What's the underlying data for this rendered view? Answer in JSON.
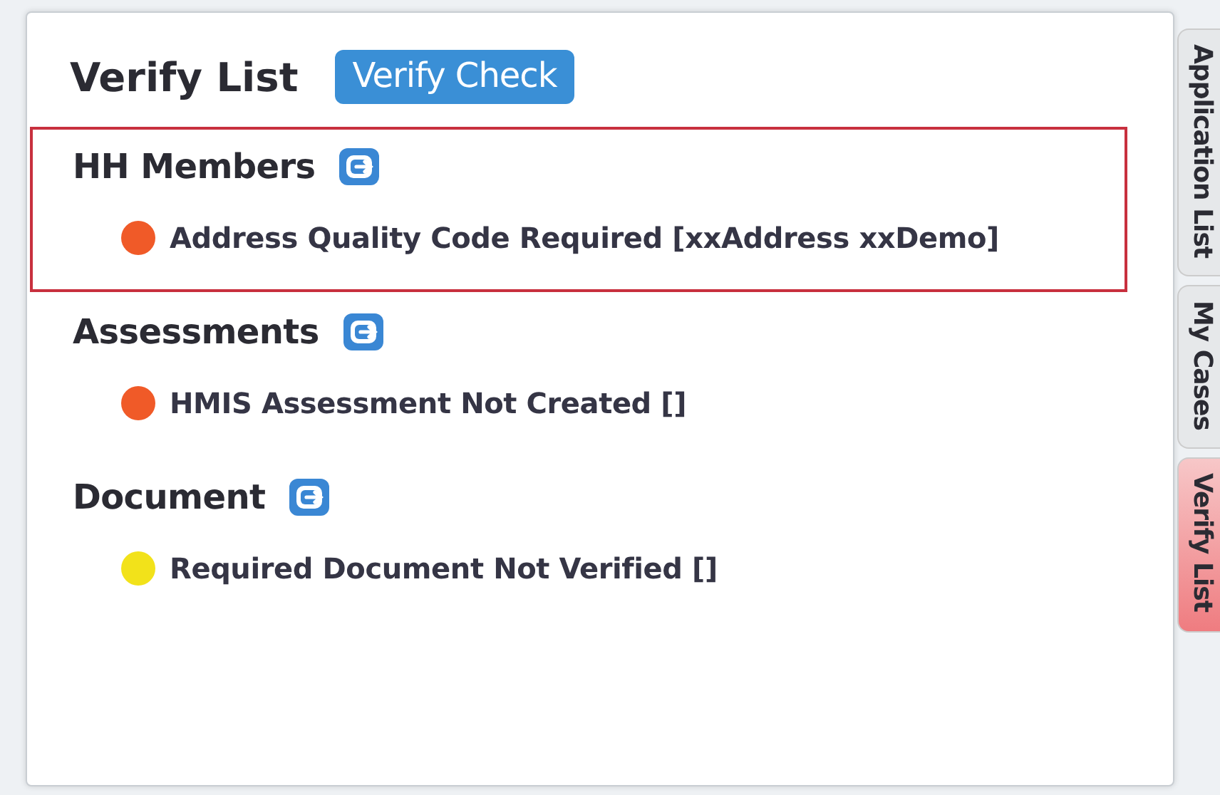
{
  "panel": {
    "title": "Verify List",
    "action_button": "Verify Check"
  },
  "sections": [
    {
      "heading": "HH Members",
      "highlighted": true,
      "items": [
        {
          "text": "Address Quality Code Required [xxAddress xxDemo]",
          "color": "#f05a28"
        }
      ]
    },
    {
      "heading": "Assessments",
      "highlighted": false,
      "items": [
        {
          "text": "HMIS Assessment Not Created []",
          "color": "#f05a28"
        }
      ]
    },
    {
      "heading": "Document",
      "highlighted": false,
      "items": [
        {
          "text": "Required Document Not Verified []",
          "color": "#f2e21a"
        }
      ]
    }
  ],
  "side_tabs": [
    {
      "label": "Application List",
      "selected": false
    },
    {
      "label": "My Cases",
      "selected": false
    },
    {
      "label": "Verify List",
      "selected": true
    }
  ]
}
